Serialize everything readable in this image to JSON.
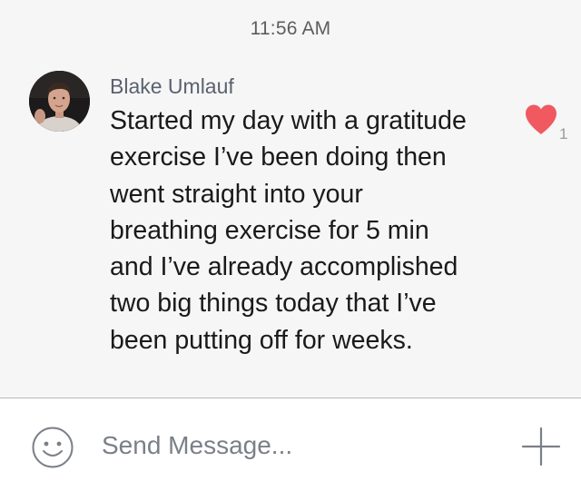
{
  "chat": {
    "timestamp": "11:56 AM",
    "message": {
      "sender": "Blake Umlauf",
      "text": "Started my day with a gratitude\nexercise I’ve been doing then\nwent straight into your\nbreathing exercise for 5 min\nand I’ve already accomplished\ntwo big things today that I’ve\nbeen putting off for weeks.",
      "reaction": {
        "icon": "heart-icon",
        "count": "1",
        "color": "#f0595f"
      }
    }
  },
  "composer": {
    "emoji_icon": "smiley-icon",
    "placeholder": "Send Message...",
    "value": "",
    "add_icon": "plus-icon"
  },
  "colors": {
    "chat_background": "#f6f6f6",
    "composer_background": "#ffffff",
    "icon_gray": "#7b7f88"
  }
}
